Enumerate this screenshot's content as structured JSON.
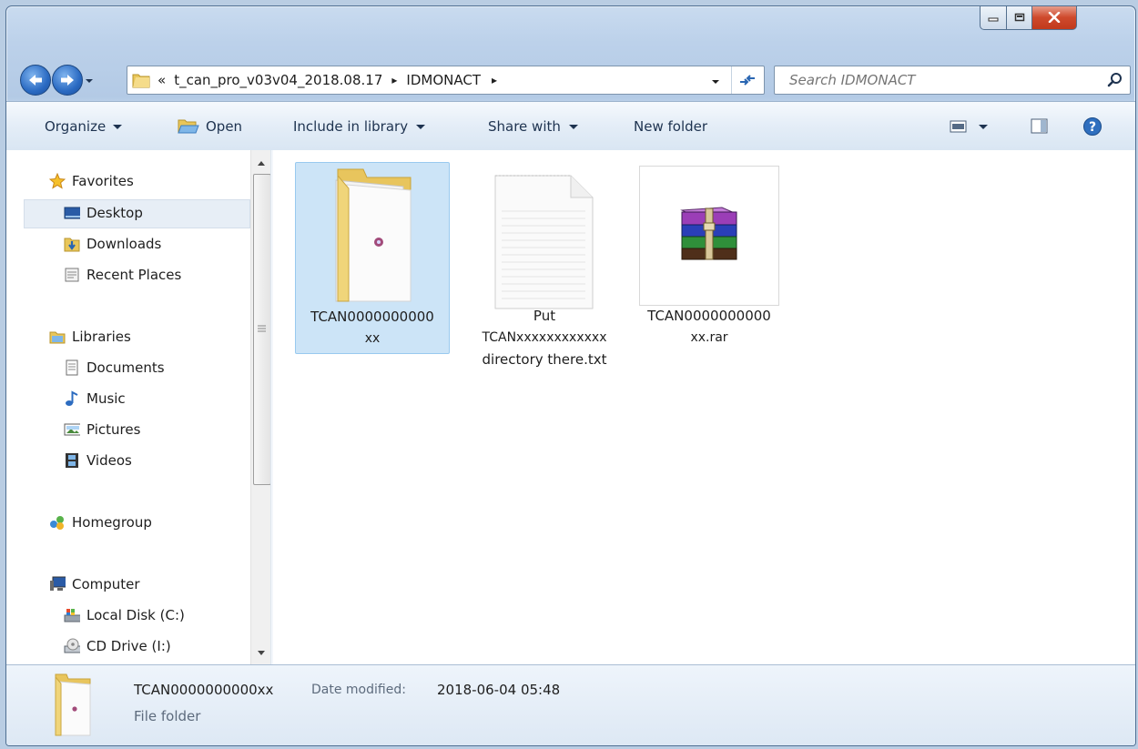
{
  "address": {
    "overflow": "«",
    "segments": [
      "t_can_pro_v03v04_2018.08.17",
      "IDMONACT"
    ],
    "separator": "▸"
  },
  "search": {
    "placeholder": "Search IDMONACT"
  },
  "toolbar": {
    "organize": "Organize",
    "open": "Open",
    "include_in_library": "Include in library",
    "share_with": "Share with",
    "new_folder": "New folder"
  },
  "nav": {
    "favorites": "Favorites",
    "desktop": "Desktop",
    "downloads": "Downloads",
    "recent_places": "Recent Places",
    "libraries": "Libraries",
    "documents": "Documents",
    "music": "Music",
    "pictures": "Pictures",
    "videos": "Videos",
    "homegroup": "Homegroup",
    "computer": "Computer",
    "local_disk": "Local Disk (C:)",
    "cd_drive": "CD Drive (I:)"
  },
  "files": [
    {
      "name_line1": "TCAN0000000000",
      "name_line2": "xx",
      "type": "folder"
    },
    {
      "name_line1": "Put",
      "name_line2": "TCANxxxxxxxxxxxx",
      "name_line3": "directory there.txt",
      "type": "text"
    },
    {
      "name_line1": "TCAN0000000000",
      "name_line2": "xx.rar",
      "type": "rar"
    }
  ],
  "details": {
    "name": "TCAN0000000000xx",
    "date_label": "Date modified:",
    "date_value": "2018-06-04 05:48",
    "type": "File folder"
  },
  "colors": {
    "selection": "#cce4f7",
    "selection_border": "#99c9ef",
    "folder": "#f0d57a"
  }
}
